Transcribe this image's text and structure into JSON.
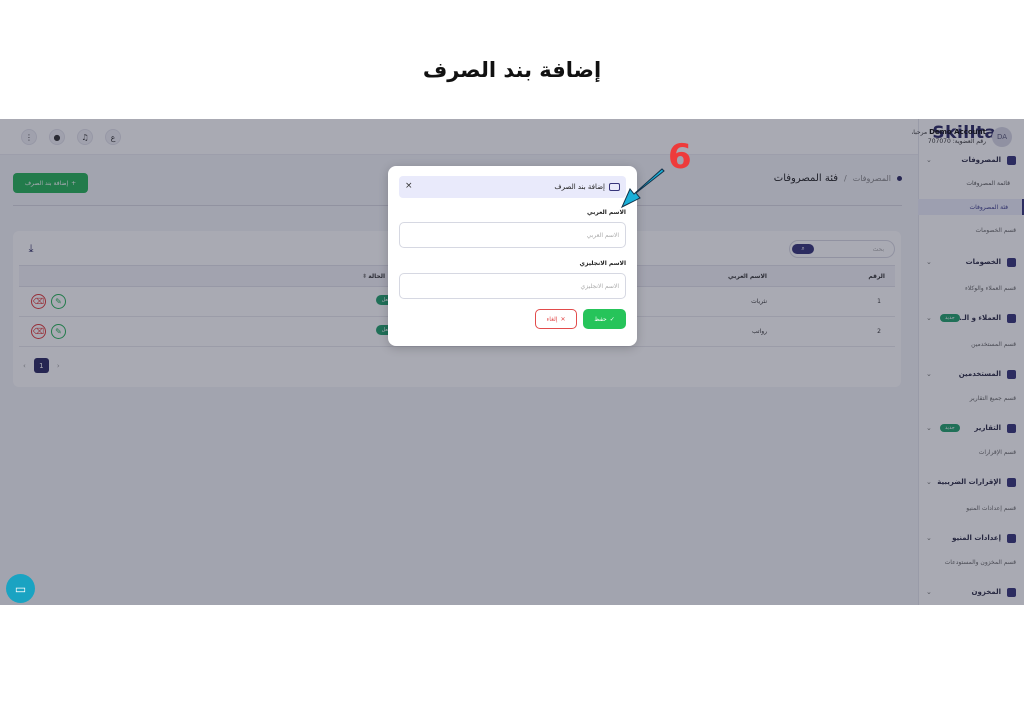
{
  "page_heading": "إضافة بند الصرف",
  "annotation": {
    "step_number": "6",
    "arrow_color": "#1ab0d8",
    "number_color": "#ee3b3b"
  },
  "topbar": {
    "user_name": "Demo Account",
    "greeting": "مرحبا،",
    "tax_number_label": "رقم العضوية: 707070",
    "avatar_initials": "DA"
  },
  "sidebar": {
    "logo": "Skilltax",
    "sections": [
      {
        "type": "group",
        "label": "المصروفات"
      },
      {
        "type": "sub",
        "label": "قائمة المصروفات"
      },
      {
        "type": "sub",
        "label": "فئة المصروفات",
        "active": true
      },
      {
        "type": "section",
        "label": "قسم الخصومات"
      },
      {
        "type": "group",
        "label": "الخصومات"
      },
      {
        "type": "section",
        "label": "قسم العملاء والوكلاء"
      },
      {
        "type": "group",
        "label": "العملاء و الـ...",
        "badge": "جديد"
      },
      {
        "type": "section",
        "label": "قسم المستخدمين"
      },
      {
        "type": "group",
        "label": "المستخدمين"
      },
      {
        "type": "section",
        "label": "قسم جميع التقارير"
      },
      {
        "type": "group",
        "label": "التقارير",
        "badge": "جديد"
      },
      {
        "type": "section",
        "label": "قسم الإقرارات"
      },
      {
        "type": "group",
        "label": "الإقرارات الضريبية"
      },
      {
        "type": "section",
        "label": "قسم إعدادات المنيو"
      },
      {
        "type": "group",
        "label": "إعدادات المنيو"
      },
      {
        "type": "section",
        "label": "قسم المخزون والمستودعات"
      },
      {
        "type": "group",
        "label": "المخزون"
      }
    ]
  },
  "breadcrumb": {
    "parent": "المصروفات",
    "separator": "/",
    "current": "فئة المصروفات"
  },
  "add_button_label": "إضافة بند الصرف",
  "search": {
    "placeholder": "بحث"
  },
  "table": {
    "headers": {
      "number": "الرقم",
      "arabic_name": "الاسم العربي",
      "status": "الحالة"
    },
    "rows": [
      {
        "number": "1",
        "arabic_name": "نثريات",
        "status": "مفعل"
      },
      {
        "number": "2",
        "arabic_name": "رواتب",
        "status": "مفعل"
      }
    ]
  },
  "pagination": {
    "prev": "‹",
    "current": "1",
    "next": "›"
  },
  "modal": {
    "title": "إضافة بند الصرف",
    "close": "×",
    "arabic_label": "الاسم العربي",
    "arabic_placeholder": "الاسم العربي",
    "english_label": "الاسم الانجليزي",
    "english_placeholder": "الاسم الانجليزي",
    "save_label": "حفظ",
    "cancel_label": "إلغاء"
  }
}
